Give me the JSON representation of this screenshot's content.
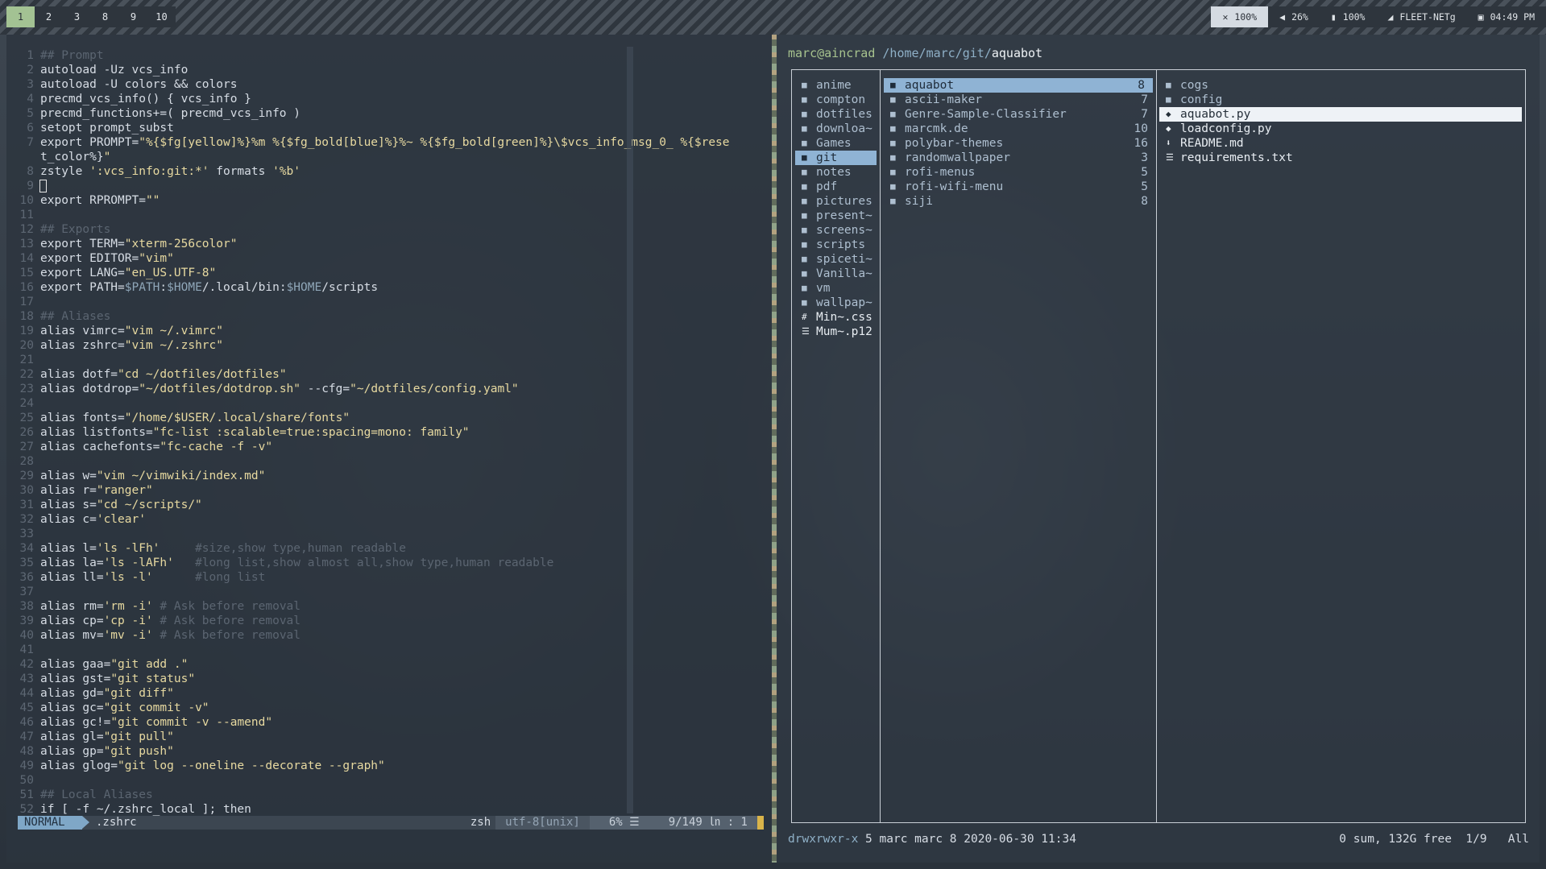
{
  "topbar": {
    "workspaces": [
      "1",
      "2",
      "3",
      "8",
      "9",
      "10"
    ],
    "active_workspace": "1",
    "status": {
      "brightness": "100%",
      "volume": "26%",
      "battery": "100%",
      "network": "FLEET-NETg",
      "time": "04:49 PM"
    }
  },
  "vim": {
    "lines": [
      {
        "n": "1",
        "t": "## Prompt",
        "c": true
      },
      {
        "n": "2",
        "t": "autoload -Uz vcs_info"
      },
      {
        "n": "3",
        "t": "autoload -U colors && colors"
      },
      {
        "n": "4",
        "t": "precmd_vcs_info() { vcs_info }"
      },
      {
        "n": "5",
        "t": "precmd_functions+=( precmd_vcs_info )"
      },
      {
        "n": "6",
        "t": "setopt prompt_subst"
      },
      {
        "n": "7",
        "t": "export PROMPT=\"%{$fg[yellow]%}%m %{$fg_bold[blue]%}%~ %{$fg_bold[green]%}\\$vcs_info_msg_0_ %{$rese"
      },
      {
        "n": "",
        "t": "t_color%}\""
      },
      {
        "n": "8",
        "t": "zstyle ':vcs_info:git:*' formats '%b'"
      },
      {
        "n": "9",
        "t": "",
        "cursor": true
      },
      {
        "n": "10",
        "t": "export RPROMPT=\"\""
      },
      {
        "n": "11",
        "t": ""
      },
      {
        "n": "12",
        "t": "## Exports",
        "c": true
      },
      {
        "n": "13",
        "t": "export TERM=\"xterm-256color\""
      },
      {
        "n": "14",
        "t": "export EDITOR=\"vim\""
      },
      {
        "n": "15",
        "t": "export LANG=\"en_US.UTF-8\""
      },
      {
        "n": "16",
        "t": "export PATH=$PATH:$HOME/.local/bin:$HOME/scripts"
      },
      {
        "n": "17",
        "t": ""
      },
      {
        "n": "18",
        "t": "## Aliases",
        "c": true
      },
      {
        "n": "19",
        "t": "alias vimrc=\"vim ~/.vimrc\""
      },
      {
        "n": "20",
        "t": "alias zshrc=\"vim ~/.zshrc\""
      },
      {
        "n": "21",
        "t": ""
      },
      {
        "n": "22",
        "t": "alias dotf=\"cd ~/dotfiles/dotfiles\""
      },
      {
        "n": "23",
        "t": "alias dotdrop=\"~/dotfiles/dotdrop.sh\" --cfg=\"~/dotfiles/config.yaml\""
      },
      {
        "n": "24",
        "t": ""
      },
      {
        "n": "25",
        "t": "alias fonts=\"/home/$USER/.local/share/fonts\""
      },
      {
        "n": "26",
        "t": "alias listfonts=\"fc-list :scalable=true:spacing=mono: family\""
      },
      {
        "n": "27",
        "t": "alias cachefonts=\"fc-cache -f -v\""
      },
      {
        "n": "28",
        "t": ""
      },
      {
        "n": "29",
        "t": "alias w=\"vim ~/vimwiki/index.md\""
      },
      {
        "n": "30",
        "t": "alias r=\"ranger\""
      },
      {
        "n": "31",
        "t": "alias s=\"cd ~/scripts/\""
      },
      {
        "n": "32",
        "t": "alias c='clear'"
      },
      {
        "n": "33",
        "t": ""
      },
      {
        "n": "34",
        "t": "alias l='ls -lFh'     ",
        "cm": "#size,show type,human readable"
      },
      {
        "n": "35",
        "t": "alias la='ls -lAFh'   ",
        "cm": "#long list,show almost all,show type,human readable"
      },
      {
        "n": "36",
        "t": "alias ll='ls -l'      ",
        "cm": "#long list"
      },
      {
        "n": "37",
        "t": ""
      },
      {
        "n": "38",
        "t": "alias rm='rm -i' ",
        "cm": "# Ask before removal"
      },
      {
        "n": "39",
        "t": "alias cp='cp -i' ",
        "cm": "# Ask before removal"
      },
      {
        "n": "40",
        "t": "alias mv='mv -i' ",
        "cm": "# Ask before removal"
      },
      {
        "n": "41",
        "t": ""
      },
      {
        "n": "42",
        "t": "alias gaa=\"git add .\""
      },
      {
        "n": "43",
        "t": "alias gst=\"git status\""
      },
      {
        "n": "44",
        "t": "alias gd=\"git diff\""
      },
      {
        "n": "45",
        "t": "alias gc=\"git commit -v\""
      },
      {
        "n": "46",
        "t": "alias gc!=\"git commit -v --amend\""
      },
      {
        "n": "47",
        "t": "alias gl=\"git pull\""
      },
      {
        "n": "48",
        "t": "alias gp=\"git push\""
      },
      {
        "n": "49",
        "t": "alias glog=\"git log --oneline --decorate --graph\""
      },
      {
        "n": "50",
        "t": ""
      },
      {
        "n": "51",
        "t": "## Local Aliases",
        "c": true
      },
      {
        "n": "52",
        "t": "if [ -f ~/.zshrc_local ]; then"
      }
    ],
    "statusline": {
      "mode": "NORMAL",
      "file": ".zshrc",
      "shell": "zsh",
      "encoding": "utf-8[unix]",
      "percent": "6% ☰",
      "position": "9/149 ㏑ :  1"
    }
  },
  "ranger": {
    "header": {
      "user": "marc@aincrad",
      "path": "/home/marc/git/",
      "current": "aquabot"
    },
    "col1": [
      {
        "name": "anime",
        "icon": "folder"
      },
      {
        "name": "compton",
        "icon": "folder"
      },
      {
        "name": "dotfiles",
        "icon": "folder"
      },
      {
        "name": "downloa~",
        "icon": "folder"
      },
      {
        "name": "Games",
        "icon": "folder"
      },
      {
        "name": "git",
        "icon": "folder",
        "selected": true
      },
      {
        "name": "notes",
        "icon": "folder"
      },
      {
        "name": "pdf",
        "icon": "folder"
      },
      {
        "name": "pictures",
        "icon": "folder"
      },
      {
        "name": "present~",
        "icon": "folder"
      },
      {
        "name": "screens~",
        "icon": "folder"
      },
      {
        "name": "scripts",
        "icon": "folder"
      },
      {
        "name": "spiceti~",
        "icon": "folder"
      },
      {
        "name": "Vanilla~",
        "icon": "folder"
      },
      {
        "name": "vm",
        "icon": "folder"
      },
      {
        "name": "wallpap~",
        "icon": "folder"
      },
      {
        "name": "Min~.css",
        "icon": "hash",
        "file": true
      },
      {
        "name": "Mum~.p12",
        "icon": "doc",
        "file": true
      }
    ],
    "col2": [
      {
        "name": "aquabot",
        "count": "8",
        "selected": true
      },
      {
        "name": "ascii-maker",
        "count": "7"
      },
      {
        "name": "Genre-Sample-Classifier",
        "count": "7"
      },
      {
        "name": "marcmk.de",
        "count": "10"
      },
      {
        "name": "polybar-themes",
        "count": "16"
      },
      {
        "name": "randomwallpaper",
        "count": "3"
      },
      {
        "name": "rofi-menus",
        "count": "5"
      },
      {
        "name": "rofi-wifi-menu",
        "count": "5"
      },
      {
        "name": "siji",
        "count": "8"
      }
    ],
    "col3": [
      {
        "name": "cogs",
        "icon": "folder"
      },
      {
        "name": "config",
        "icon": "folder"
      },
      {
        "name": "aquabot.py",
        "icon": "py",
        "highlight": true
      },
      {
        "name": "loadconfig.py",
        "icon": "py",
        "file": true
      },
      {
        "name": "README.md",
        "icon": "md",
        "file": true
      },
      {
        "name": "requirements.txt",
        "icon": "doc",
        "file": true
      }
    ],
    "footer": {
      "perm": "drwxrwxr-x",
      "meta": " 5 marc marc 8 2020-06-30 11:34",
      "right": "0 sum, 132G free  1/9   All"
    }
  },
  "colors": {
    "accent_green": "#a3c293",
    "selection_blue": "#8fb3d4",
    "string_yellow": "#e7d9a0",
    "comment_gray": "#5b6571"
  }
}
